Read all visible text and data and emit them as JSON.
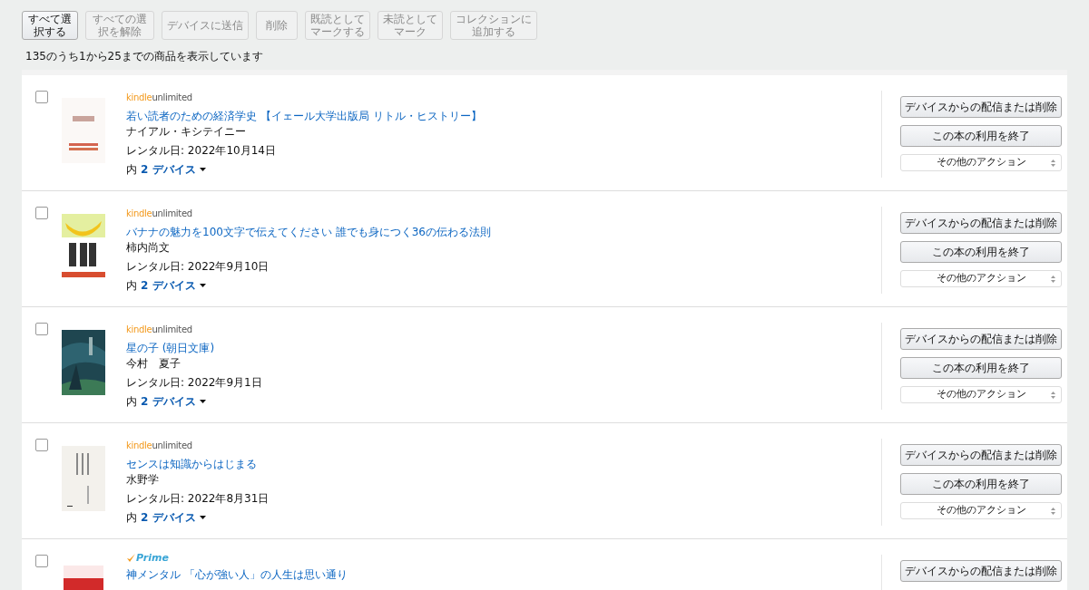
{
  "toolbar": [
    {
      "label": "すべて選択する",
      "disabled": false
    },
    {
      "label": "すべての選択を解除",
      "disabled": true
    },
    {
      "label": "デバイスに送信",
      "disabled": true
    },
    {
      "label": "削除",
      "disabled": true
    },
    {
      "label": "既読としてマークする",
      "disabled": true
    },
    {
      "label": "未読としてマーク",
      "disabled": true
    },
    {
      "label": "コレクションに追加する",
      "disabled": true
    }
  ],
  "summary": "135のうち1から25までの商品を表示しています",
  "items": [
    {
      "checked": false,
      "badge": {
        "kind": "kindle_unlimited",
        "words": [
          "kindle",
          "unlimited"
        ]
      },
      "cover": {
        "kind": "picture"
      },
      "title": "若い読者のための経済学史 【イェール大学出版局 リトル・ヒストリー】",
      "author": "ナイアル・キシテイニー",
      "rental": "レンタル日: 2022年10月14日",
      "devices_prefix": "内",
      "devices_link": "2 デバイス",
      "actions": [
        {
          "kind": "button",
          "label": "デバイスからの配信または削除"
        },
        {
          "kind": "button",
          "label": "この本の利用を終了"
        },
        {
          "kind": "select",
          "label": "その他のアクション"
        }
      ]
    },
    {
      "checked": false,
      "badge": {
        "kind": "kindle_unlimited",
        "words": [
          "kindle",
          "unlimited"
        ]
      },
      "cover": {
        "kind": "picture"
      },
      "title": "バナナの魅力を100文字で伝えてください 誰でも身につく36の伝わる法則",
      "author": "柿内尚文",
      "rental": "レンタル日: 2022年9月10日",
      "devices_prefix": "内",
      "devices_link": "2 デバイス",
      "actions": [
        {
          "kind": "button",
          "label": "デバイスからの配信または削除"
        },
        {
          "kind": "button",
          "label": "この本の利用を終了"
        },
        {
          "kind": "select",
          "label": "その他のアクション"
        }
      ]
    },
    {
      "checked": false,
      "badge": {
        "kind": "kindle_unlimited",
        "words": [
          "kindle",
          "unlimited"
        ]
      },
      "cover": {
        "kind": "picture"
      },
      "title": "星の子 (朝日文庫)",
      "author": "今村　夏子",
      "rental": "レンタル日: 2022年9月1日",
      "devices_prefix": "内",
      "devices_link": "2 デバイス",
      "actions": [
        {
          "kind": "button",
          "label": "デバイスからの配信または削除"
        },
        {
          "kind": "button",
          "label": "この本の利用を終了"
        },
        {
          "kind": "select",
          "label": "その他のアクション"
        }
      ]
    },
    {
      "checked": false,
      "badge": {
        "kind": "kindle_unlimited",
        "words": [
          "kindle",
          "unlimited"
        ]
      },
      "cover": {
        "kind": "picture"
      },
      "title": "センスは知識からはじまる",
      "author": "水野学",
      "rental": "レンタル日: 2022年8月31日",
      "devices_prefix": "内",
      "devices_link": "2 デバイス",
      "actions": [
        {
          "kind": "button",
          "label": "デバイスからの配信または削除"
        },
        {
          "kind": "button",
          "label": "この本の利用を終了"
        },
        {
          "kind": "select",
          "label": "その他のアクション"
        }
      ]
    },
    {
      "checked": false,
      "badge": {
        "kind": "prime",
        "words": [
          "Prime"
        ]
      },
      "cover": {
        "kind": "picture"
      },
      "title": "神メンタル 「心が強い人」の人生は思い通り",
      "actions": [
        {
          "kind": "button",
          "label": "デバイスからの配信または削除"
        }
      ]
    }
  ]
}
